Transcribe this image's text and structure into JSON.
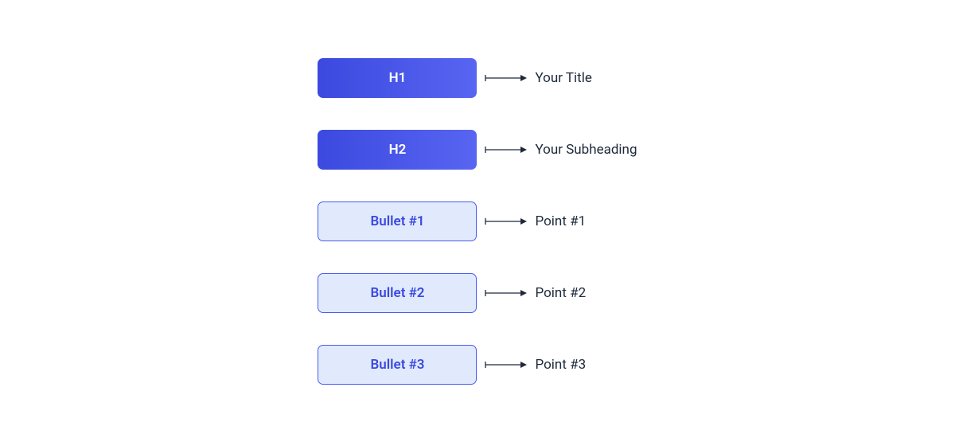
{
  "rows": [
    {
      "block_label": "H1",
      "description": "Your Title",
      "variant": "primary"
    },
    {
      "block_label": "H2",
      "description": "Your Subheading",
      "variant": "primary"
    },
    {
      "block_label": "Bullet #1",
      "description": "Point #1",
      "variant": "secondary"
    },
    {
      "block_label": "Bullet #2",
      "description": "Point #2",
      "variant": "secondary"
    },
    {
      "block_label": "Bullet #3",
      "description": "Point #3",
      "variant": "secondary"
    }
  ],
  "colors": {
    "primary_gradient_start": "#3b49df",
    "primary_gradient_end": "#5865f2",
    "secondary_bg": "#e1eafd",
    "secondary_border": "#4b5bef",
    "secondary_text": "#3b49df",
    "desc_text": "#1e293b",
    "arrow": "#1e293b"
  }
}
